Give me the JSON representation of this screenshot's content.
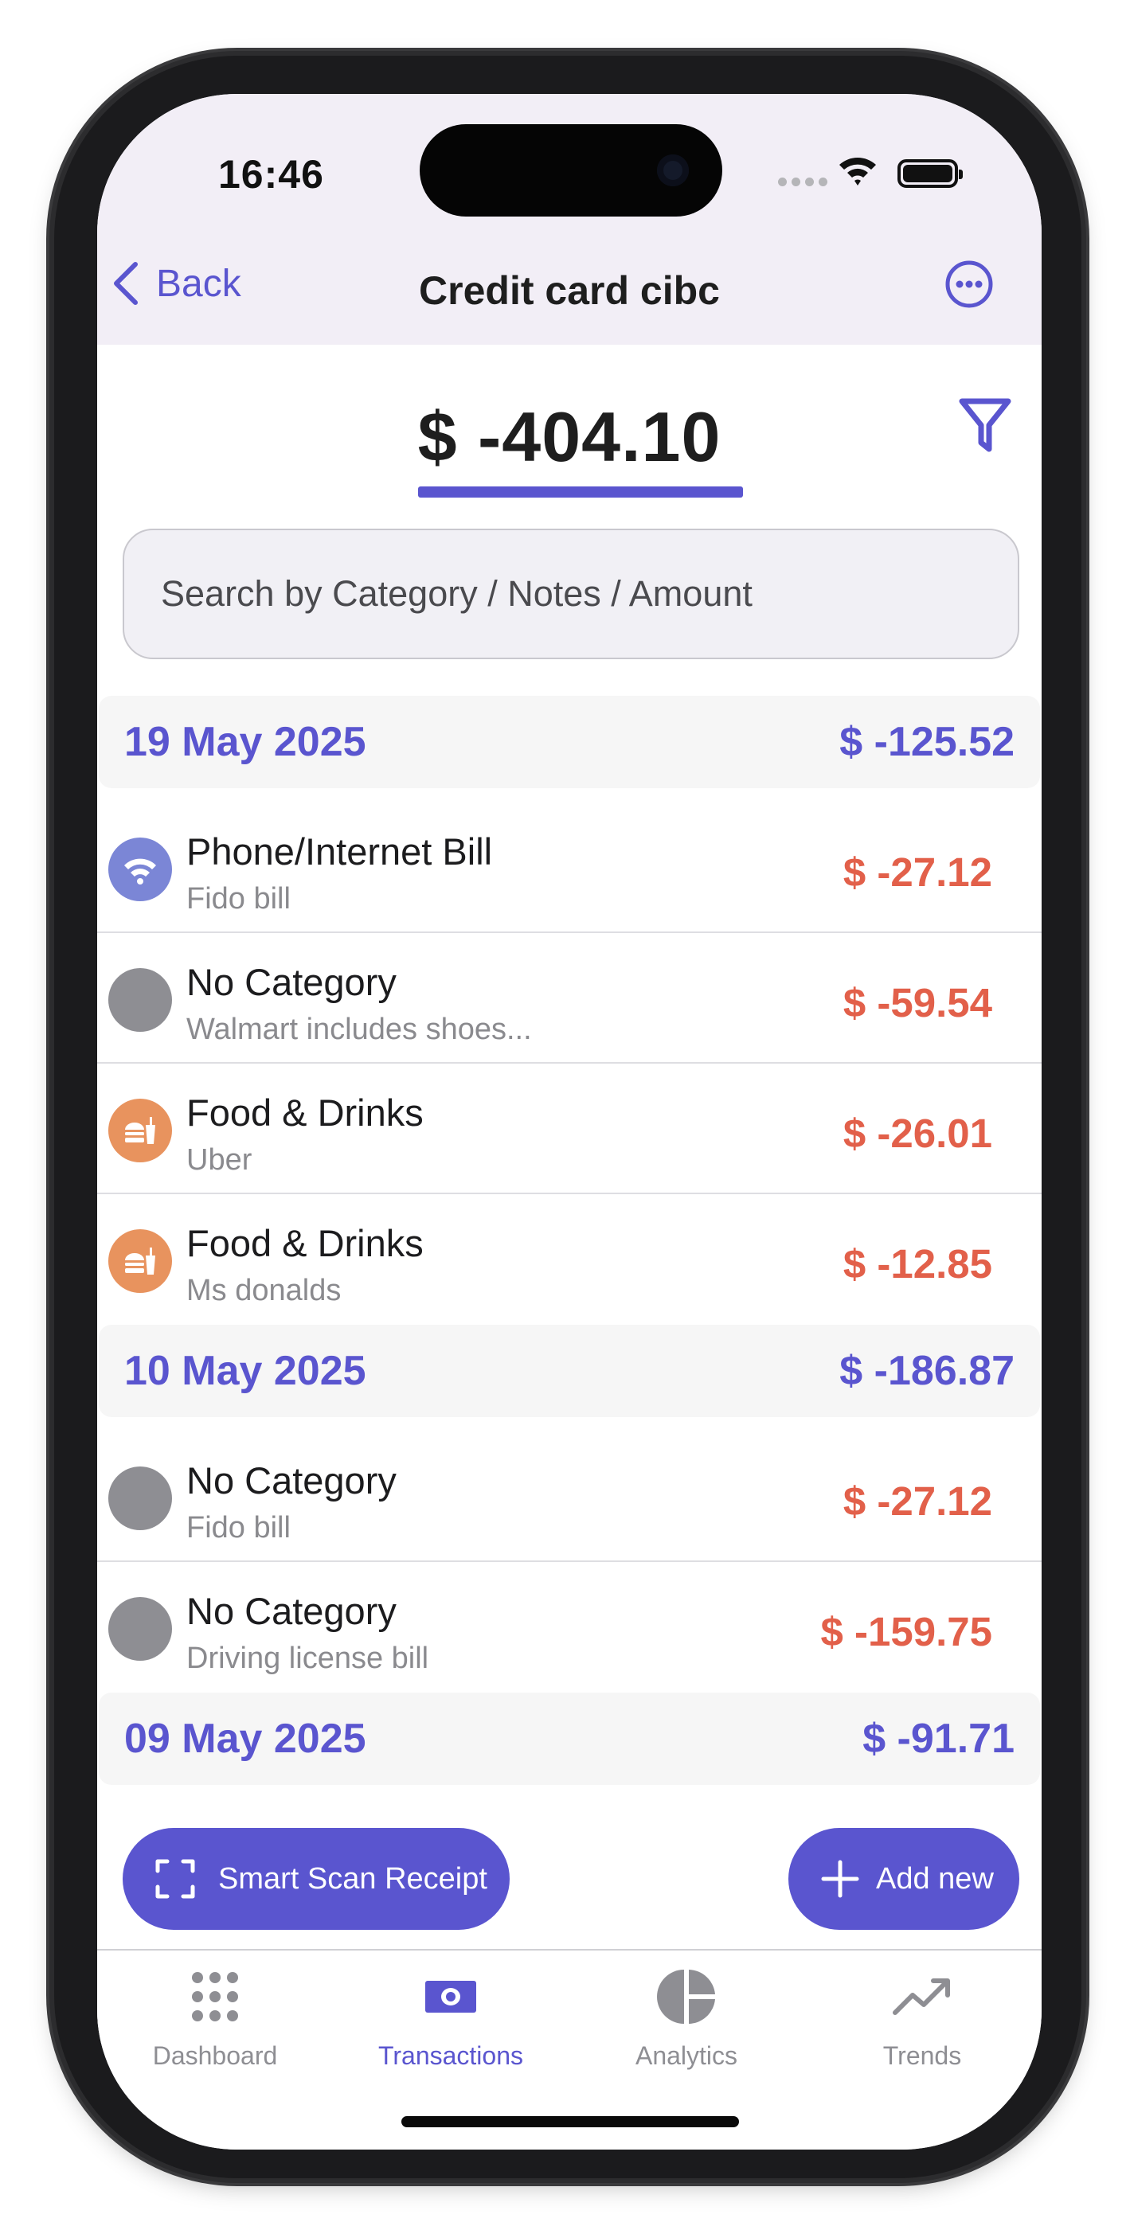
{
  "status": {
    "time": "16:46"
  },
  "nav": {
    "back_label": "Back",
    "title": "Credit card cibc"
  },
  "balance": {
    "value": "$ -404.10"
  },
  "search": {
    "placeholder": "Search by Category / Notes / Amount"
  },
  "colors": {
    "accent": "#5a55cf",
    "expense": "#e2604a",
    "header_bg": "#f2eef6"
  },
  "groups": [
    {
      "date": "19 May 2025",
      "total": "$ -125.52",
      "transactions": [
        {
          "category": "Phone/Internet Bill",
          "note": "Fido bill",
          "amount": "$ -27.12",
          "icon": "wifi-icon",
          "icon_color": "#7b86d6"
        },
        {
          "category": "No Category",
          "note": "Walmart includes shoes...",
          "amount": "$ -59.54",
          "icon": "none",
          "icon_color": "#8e8e93"
        },
        {
          "category": "Food & Drinks",
          "note": "Uber",
          "amount": "$ -26.01",
          "icon": "fast-food-icon",
          "icon_color": "#e8935e"
        },
        {
          "category": "Food & Drinks",
          "note": "Ms donalds",
          "amount": "$ -12.85",
          "icon": "fast-food-icon",
          "icon_color": "#e8935e"
        }
      ]
    },
    {
      "date": "10 May 2025",
      "total": "$ -186.87",
      "transactions": [
        {
          "category": "No Category",
          "note": "Fido bill",
          "amount": "$ -27.12",
          "icon": "none",
          "icon_color": "#8e8e93"
        },
        {
          "category": "No Category",
          "note": "Driving license bill",
          "amount": "$ -159.75",
          "icon": "none",
          "icon_color": "#8e8e93"
        }
      ]
    },
    {
      "date": "09 May 2025",
      "total": "$ -91.71",
      "transactions": []
    }
  ],
  "actions": {
    "scan_label": "Smart Scan Receipt",
    "add_label": "Add new"
  },
  "tabs": [
    {
      "label": "Dashboard",
      "icon": "grid-icon",
      "active": false
    },
    {
      "label": "Transactions",
      "icon": "money-icon",
      "active": true
    },
    {
      "label": "Analytics",
      "icon": "pie-chart-icon",
      "active": false
    },
    {
      "label": "Trends",
      "icon": "trend-icon",
      "active": false
    }
  ]
}
